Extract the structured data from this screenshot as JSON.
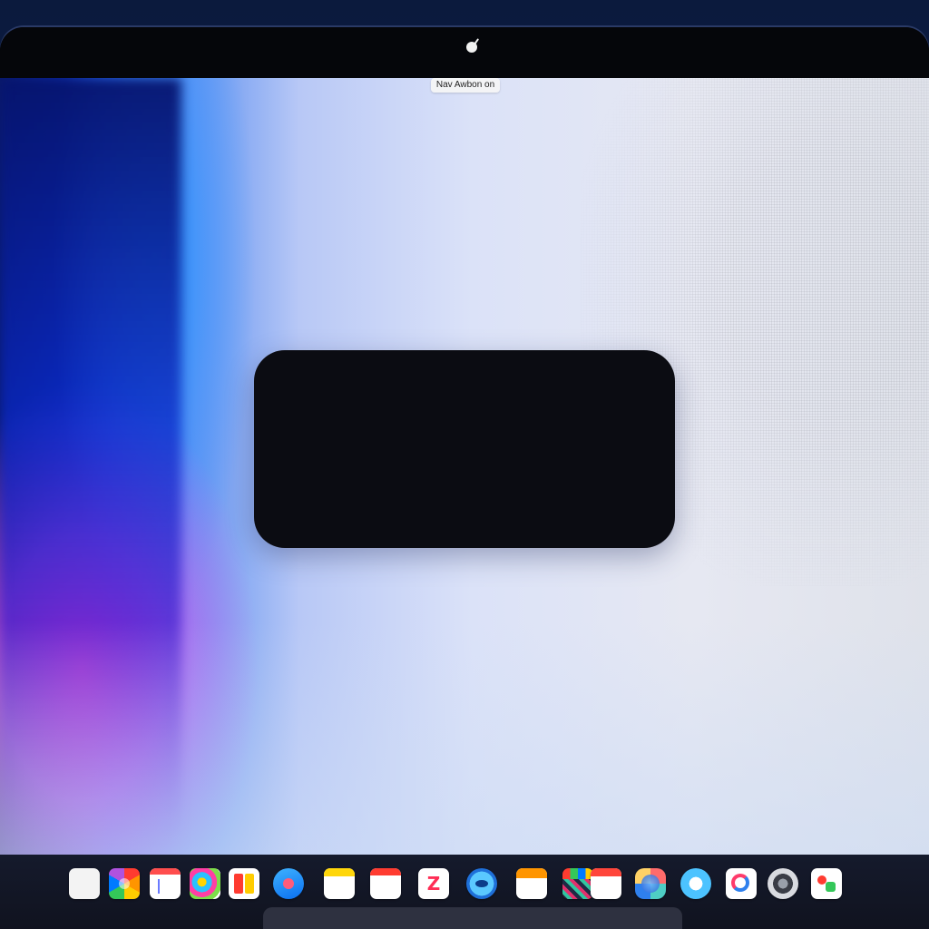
{
  "device": {
    "top_label": "Nav Awbon on"
  },
  "dock": {
    "apps": [
      {
        "name": "blank-app-icon"
      },
      {
        "name": "photos-icon"
      },
      {
        "name": "document-icon"
      },
      {
        "name": "color-ball-icon"
      },
      {
        "name": "letter-blocks-icon"
      },
      {
        "name": "blue-round-app-icon"
      },
      {
        "name": "notes-icon"
      },
      {
        "name": "calendar-icon"
      },
      {
        "name": "z-app-icon"
      },
      {
        "name": "fish-app-icon"
      },
      {
        "name": "orange-header-app-icon"
      },
      {
        "name": "mosaic-app-icon"
      },
      {
        "name": "calendar-red-icon"
      },
      {
        "name": "globe-app-icon"
      },
      {
        "name": "siri-icon"
      },
      {
        "name": "swirl-app-icon"
      },
      {
        "name": "monochrome-app-icon"
      },
      {
        "name": "art-app-icon"
      }
    ]
  },
  "colors": {
    "bezel": "#05060c",
    "panel": "#0b0c12",
    "dock": "#151a2c",
    "wallpaper_blue": "#1b4fe0",
    "wallpaper_magenta": "#ff46dc"
  }
}
